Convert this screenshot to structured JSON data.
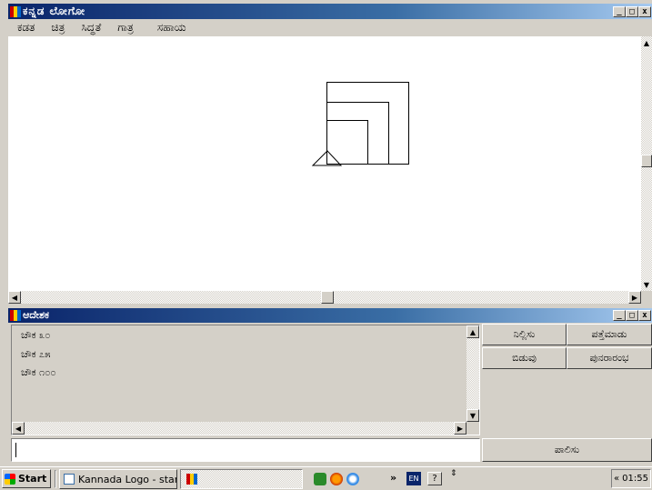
{
  "app": {
    "title": "ಕನ್ನಡ ಲೋಗೋ",
    "menu": [
      "ಕಡತ",
      "ಚಿತ್ರ",
      "ಸಿದ್ಧತೆ",
      "ಗಾತ್ರ",
      "ಸಹಾಯ"
    ]
  },
  "console": {
    "title": "ಆದೇಶಕ",
    "history": [
      "ಚೌಕ ೩೦",
      "ಚೌಕ ೭೫",
      "ಚೌಕ ೧೦೦"
    ],
    "input_value": "",
    "buttons": {
      "stop": "ನಿಲ್ಲಿಸು",
      "trace": "ಪತ್ತೆಮಾಡು",
      "pause": "ಬಿಡುವು",
      "resume": "ಪುನರಾರಂಭ",
      "execute": "ಪಾಲಿಸು"
    }
  },
  "taskbar": {
    "start_label": "Start",
    "task_label": "Kannada Logo - start...",
    "lang": "EN",
    "clock": "01:55",
    "chevron": "«",
    "overflow": "»"
  },
  "colors": {
    "titlebar_start": "#0a246a",
    "titlebar_end": "#a6caf0",
    "face": "#d4d0c8",
    "canvas": "#ffffff"
  }
}
